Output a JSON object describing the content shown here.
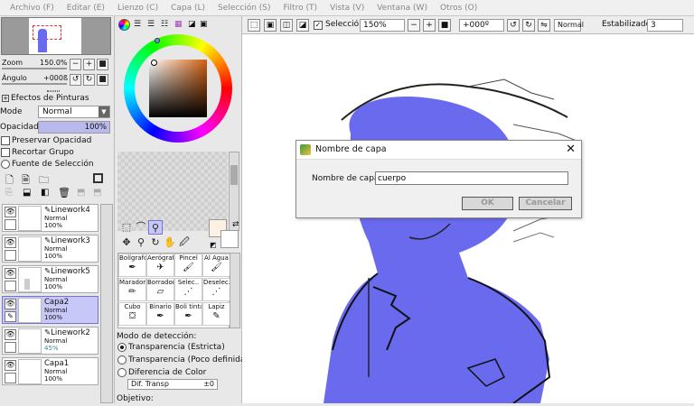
{
  "menubar": {
    "items": [
      "Archivo (F)",
      "Editar (E)",
      "Lienzo (C)",
      "Capa (L)",
      "Selección (S)",
      "Filtro (T)",
      "Vista (V)",
      "Ventana (W)",
      "Otros (O)"
    ]
  },
  "navigator": {
    "zoom_label": "Zoom",
    "zoom_value": "150.0%",
    "angle_label": "Ángulo",
    "angle_value": "+000ß"
  },
  "layer_props": {
    "effects_label": "Efectos de Pinturas",
    "mode_label": "Mode",
    "mode_value": "Normal",
    "opacity_label": "Opacidad",
    "opacity_value": "100%",
    "opacity_fraction": 1.0,
    "preserve_opacity": "Preservar Opacidad",
    "clip_group": "Recortar Grupo",
    "selection_source": "Fuente de Selección"
  },
  "layers": [
    {
      "name": "Linework4",
      "mode": "Normal",
      "opacity": "100%",
      "selected": false
    },
    {
      "name": "Linework3",
      "mode": "Normal",
      "opacity": "100%",
      "selected": false
    },
    {
      "name": "Linework5",
      "mode": "Normal",
      "opacity": "100%",
      "selected": false
    },
    {
      "name": "Capa2",
      "mode": "Normal",
      "opacity": "100%",
      "selected": true
    },
    {
      "name": "Linework2",
      "mode": "Normal",
      "opacity": "45%",
      "selected": false
    },
    {
      "name": "Capa1",
      "mode": "Normal",
      "opacity": "100%",
      "selected": false
    }
  ],
  "colors": {
    "accent_selected": "#c7c8f8",
    "fill_blue": "#6a6aee",
    "primary_swatch": "#fdf1e4",
    "secondary_swatch": "#ffffff",
    "layer_opacity_highlight": "#3a8a8a"
  },
  "brushes": [
    [
      "Bolígrafo",
      "Aerógraf",
      "Pincel",
      "Al Agua"
    ],
    [
      "Marador",
      "Borrador",
      "Selec..",
      "Deselec.."
    ],
    [
      "Cubo",
      "Binario",
      "Boli tinta",
      "Lapiz"
    ]
  ],
  "tool_options": {
    "detection_label": "Modo de detección:",
    "options": [
      "Transparencia (Estricta)",
      "Transparencia (Poco definida)",
      "Diferencia de Color"
    ],
    "selected_index": 0,
    "dif_label": "Dif. Transp",
    "dif_value": "±0",
    "objective_label": "Objetivo:"
  },
  "canvas_toolbar": {
    "selection_label": "Selección",
    "zoom_value": "150%",
    "angle_value": "+000º",
    "mode_value": "Normal",
    "stabilizer_label": "Estabilizador",
    "stabilizer_value": "3"
  },
  "dialog": {
    "title": "Nombre de capa",
    "field_label": "Nombre de capa:",
    "field_value": "cuerpo",
    "ok_label": "OK",
    "cancel_label": "Cancelar"
  }
}
